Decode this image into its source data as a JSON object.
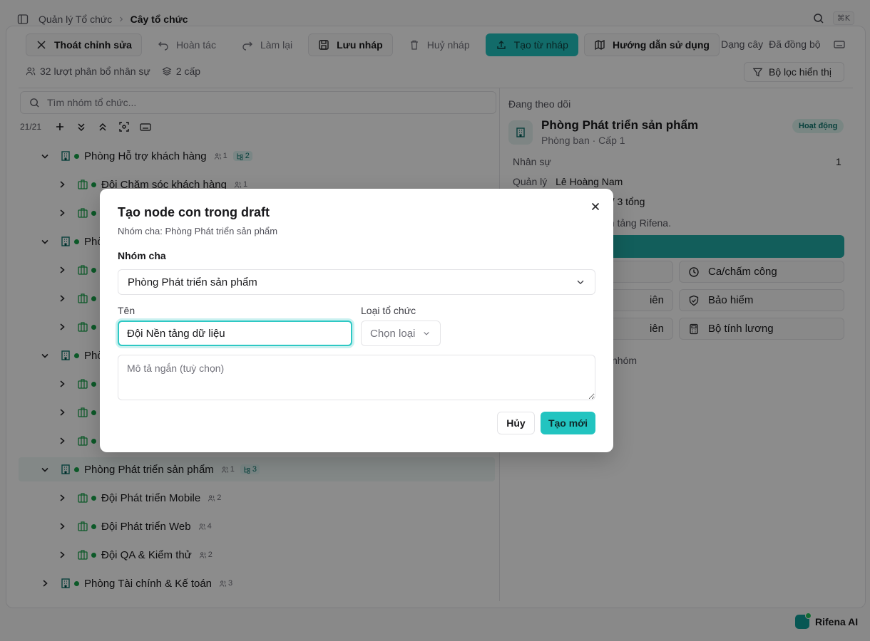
{
  "breadcrumb": {
    "parent": "Quản lý Tổ chức",
    "current": "Cây tổ chức"
  },
  "shortcut": "⌘K",
  "toolbar": {
    "exit_edit": "Thoát chỉnh sửa",
    "undo": "Hoàn tác",
    "redo": "Làm lại",
    "save_draft": "Lưu nháp",
    "discard_draft": "Huỷ nháp",
    "create_from_draft": "Tạo từ nháp",
    "guide": "Hướng dẫn sử dụng",
    "view_mode": "Dạng cây",
    "sync_status": "Đã đồng bộ"
  },
  "stats": {
    "allocations": "32 lượt phân bổ nhân sự",
    "levels": "2 cấp"
  },
  "filter_label": "Bộ lọc hiển thị",
  "tree": {
    "search_placeholder": "Tìm nhóm tổ chức...",
    "count": "21/21",
    "rows": [
      {
        "label": "Phòng Hỗ trợ khách hàng",
        "members": "1",
        "children": "2",
        "level": 0,
        "expanded": true
      },
      {
        "label": "Đội Chăm sóc khách hàng",
        "members": "1",
        "children": "",
        "level": 1,
        "expanded": false
      },
      {
        "label": "",
        "members": "",
        "children": "",
        "level": 1,
        "expanded": false
      },
      {
        "label": "Phò",
        "members": "",
        "children": "",
        "level": 0,
        "expanded": true
      },
      {
        "label": "",
        "members": "",
        "children": "",
        "level": 1,
        "expanded": false
      },
      {
        "label": "",
        "members": "",
        "children": "",
        "level": 1,
        "expanded": false
      },
      {
        "label": "",
        "members": "",
        "children": "",
        "level": 1,
        "expanded": false
      },
      {
        "label": "Phò",
        "members": "",
        "children": "",
        "level": 0,
        "expanded": true
      },
      {
        "label": "",
        "members": "",
        "children": "",
        "level": 1,
        "expanded": false
      },
      {
        "label": "",
        "members": "",
        "children": "",
        "level": 1,
        "expanded": false
      },
      {
        "label": "",
        "members": "",
        "children": "",
        "level": 1,
        "expanded": false
      },
      {
        "label": "Phòng Phát triển sản phẩm",
        "members": "1",
        "children": "3",
        "level": 0,
        "expanded": true,
        "selected": true
      },
      {
        "label": "Đội Phát triển Mobile",
        "members": "2",
        "children": "",
        "level": 1,
        "expanded": false
      },
      {
        "label": "Đội Phát triển Web",
        "members": "4",
        "children": "",
        "level": 1,
        "expanded": false
      },
      {
        "label": "Đội QA & Kiểm thử",
        "members": "2",
        "children": "",
        "level": 1,
        "expanded": false
      },
      {
        "label": "Phòng Tài chính & Kế toán",
        "members": "3",
        "children": "",
        "level": 0,
        "expanded": false
      }
    ]
  },
  "panel": {
    "heading": "Đang theo dõi",
    "name": "Phòng Phát triển sản phẩm",
    "subtitle": "Phòng ban · Cấp 1",
    "status": "Hoạt động",
    "staff_label": "Nhân sự",
    "staff_value": "1",
    "manager_label": "Quản lý",
    "manager_value": "Lê Hoàng Nam",
    "levels_partial": "g / 3 tổng",
    "platform_partial": "ền tảng Rifena.",
    "btn_attendance": "Ca/chấm công",
    "btn_insurance": "Bảo hiểm",
    "btn_payroll": "Bộ tính lương",
    "btn_partial_1": "iên",
    "btn_partial_2": "iên",
    "group_partial": "nhóm"
  },
  "dialog": {
    "title": "Tạo node con trong draft",
    "subtitle": "Nhóm cha: Phòng Phát triển sản phẩm",
    "parent_label": "Nhóm cha",
    "parent_value": "Phòng Phát triển sản phẩm",
    "name_label": "Tên",
    "name_value": "Đội Nền tảng dữ liệu",
    "type_label": "Loại tổ chức",
    "type_placeholder": "Chọn loại",
    "desc_placeholder": "Mô tả ngắn (tuỳ chọn)",
    "cancel": "Hủy",
    "create": "Tạo mới"
  },
  "assistant": "Rifena AI",
  "colors": {
    "accent": "#22c4c0",
    "status_green": "#16a34a"
  }
}
